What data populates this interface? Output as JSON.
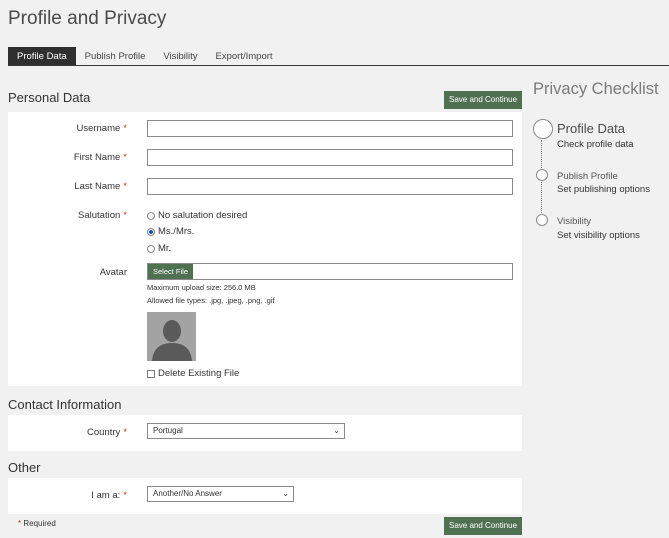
{
  "page": {
    "title": "Profile and Privacy"
  },
  "tabs": [
    {
      "label": "Profile Data",
      "active": true
    },
    {
      "label": "Publish Profile",
      "active": false
    },
    {
      "label": "Visibility",
      "active": false
    },
    {
      "label": "Export/Import",
      "active": false
    }
  ],
  "personal": {
    "title": "Personal Data",
    "save_label": "Save and Continue",
    "username_label": "Username",
    "firstname_label": "First Name",
    "lastname_label": "Last Name",
    "salutation_label": "Salutation",
    "salutation_options": [
      "No salutation desired",
      "Ms./Mrs.",
      "Mr."
    ],
    "salutation_selected": "Ms./Mrs.",
    "avatar_label": "Avatar",
    "select_file_label": "Select File",
    "max_upload": "Maximum upload size: 256.0 MB",
    "allowed_types": "Allowed file types: .jpg, .jpeg, .png, .gif",
    "delete_label": "Delete Existing File"
  },
  "contact": {
    "title": "Contact Information",
    "country_label": "Country",
    "country_value": "Portugal"
  },
  "other": {
    "title": "Other",
    "iam_label": "I am a:",
    "iam_value": "Another/No Answer"
  },
  "footer": {
    "required_star": "*",
    "required_label": "Required",
    "save_label": "Save and Continue"
  },
  "required_mark": "*",
  "checklist": {
    "title": "Privacy Checklist",
    "steps": [
      {
        "title": "Profile Data",
        "subtitle": "Check profile data",
        "current": true
      },
      {
        "title": "Publish Profile",
        "subtitle": "Set publishing options",
        "current": false
      },
      {
        "title": "Visibility",
        "subtitle": "Set visibility options",
        "current": false
      }
    ]
  },
  "colors": {
    "accent_green": "#4f7151",
    "tab_active": "#2f2f2f",
    "required_red": "#c0392b"
  }
}
